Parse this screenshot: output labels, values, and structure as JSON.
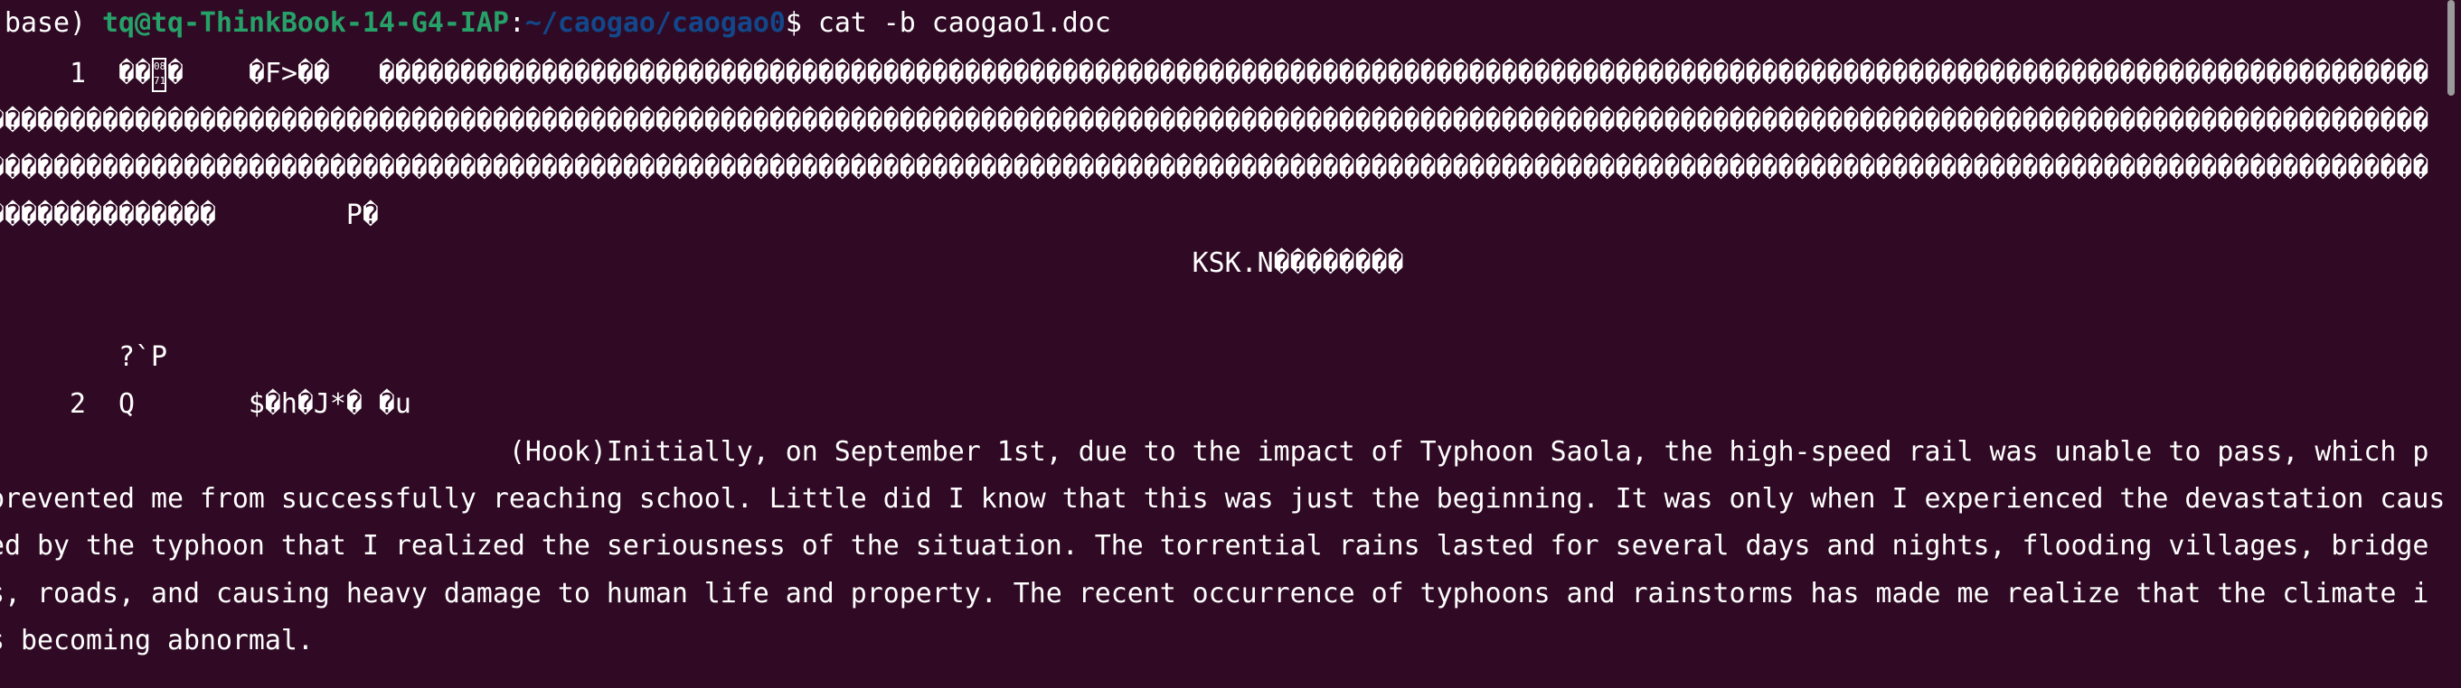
{
  "prompt": {
    "env": "(base) ",
    "user_host": "tq@tq-ThinkBook-14-G4-IAP",
    "sep": ":",
    "path": "~/caogao/caogao0",
    "command": "$ cat -b caogao1.doc"
  },
  "line1": {
    "pre": "     1  ��",
    "box_glyph": [
      "08",
      "71"
    ],
    "post": "�    �F>��   ������������������������������������������������������������������������������������������������������������������������������"
  },
  "rows": [
    {
      "row": 2,
      "text": "������������������������������������������������������������������������������������������������������������������������������������������������������"
    },
    {
      "row": 3,
      "text": "������������������������������������������������������������������������������������������������������������������������������������������������������"
    },
    {
      "row": 4,
      "text": "��������������        P�"
    },
    {
      "row": 5,
      "text": "                                                                          KSK.N��������"
    },
    {
      "row": 7,
      "text": "        ?`P"
    },
    {
      "row": 8,
      "text": "     2  Q       $�h�J*� �u"
    },
    {
      "row": 9,
      "text": "                                (Hook)Initially, on September 1st, due to the impact of Typhoon Saola, the high-speed rail was unable to pass, which p"
    },
    {
      "row": 10,
      "text": "prevented me from successfully reaching school. Little did I know that this was just the beginning. It was only when I experienced the devastation caus"
    },
    {
      "row": 11,
      "text": "ed by the typhoon that I realized the seriousness of the situation. The torrential rains lasted for several days and nights, flooding villages, bridge"
    },
    {
      "row": 12,
      "text": "s, roads, and causing heavy damage to human life and property. The recent occurrence of typhoons and rainstorms has made me realize that the climate i"
    },
    {
      "row": 13,
      "text": "s becoming abnormal."
    }
  ]
}
